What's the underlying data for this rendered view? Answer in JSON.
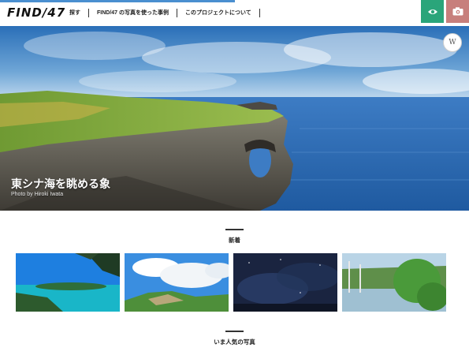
{
  "header": {
    "logo": "FIND/47",
    "nav": [
      "探す",
      "FIND/47 の写真を使った事例",
      "このプロジェクトについて"
    ],
    "view_icon": "eye-icon",
    "photo_icon": "camera-icon",
    "colors": {
      "view_button": "#2aa57a",
      "photo_button": "#c77f7c",
      "progress_bar": "#4a8fd0"
    }
  },
  "hero": {
    "title": "東シナ海を眺める象",
    "credit": "Photo by Hiroki Iwata",
    "badge": "W"
  },
  "sections": {
    "new": {
      "title": "新着"
    },
    "popular": {
      "title": "いま人気の写真"
    }
  },
  "thumbnails": [
    {
      "name": "thumb-tropical-bay"
    },
    {
      "name": "thumb-green-hills-clouds"
    },
    {
      "name": "thumb-night-sky"
    },
    {
      "name": "thumb-river-forest"
    }
  ]
}
